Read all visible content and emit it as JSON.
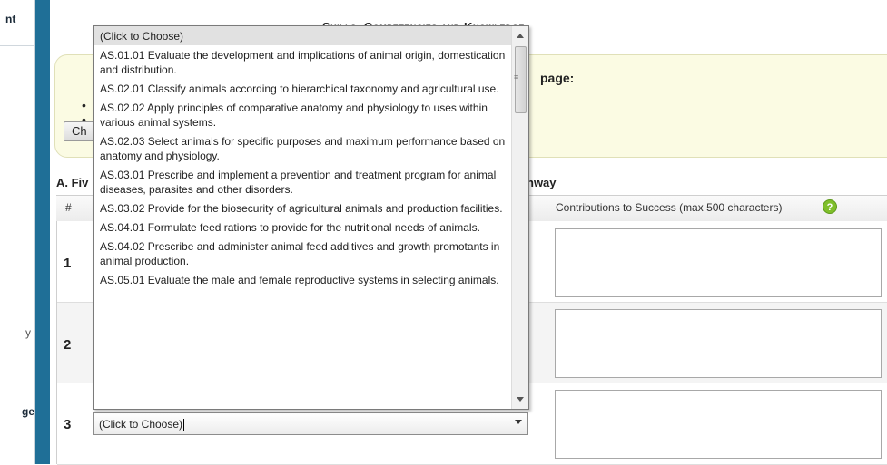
{
  "sidebar": {
    "cut_labels": [
      "nt",
      "y",
      "ge"
    ]
  },
  "page": {
    "heading": "Skills, Competencies and Knowledge"
  },
  "info": {
    "title": "page:",
    "bullets": [
      "•",
      "•"
    ],
    "button_label": "Ch"
  },
  "section": {
    "heading": "A. Fiv",
    "heading_tail": "hway"
  },
  "table": {
    "columns": [
      "#",
      "Contributions to Success (max 500 characters)"
    ],
    "help_icon": "?",
    "rows": [
      {
        "num": "1"
      },
      {
        "num": "2"
      },
      {
        "num": "3"
      }
    ]
  },
  "select": {
    "value": "(Click to Choose)"
  },
  "dropdown": {
    "options": [
      "(Click to Choose)",
      "AS.01.01 Evaluate the development and implications of animal origin, domestication and distribution.",
      "AS.02.01 Classify animals according to hierarchical taxonomy and agricultural use.",
      "AS.02.02 Apply principles of comparative anatomy and physiology to uses within various animal systems.",
      "AS.02.03 Select animals for specific purposes and maximum performance based on anatomy and physiology.",
      "AS.03.01 Prescribe and implement a prevention and treatment program for animal diseases, parasites and other disorders.",
      "AS.03.02 Provide for the biosecurity of agricultural animals and production facilities.",
      "AS.04.01 Formulate feed rations to provide for the nutritional needs of animals.",
      "AS.04.02 Prescribe and administer animal feed additives and growth promotants in animal production.",
      "AS.05.01 Evaluate the male and female reproductive systems in selecting animals."
    ],
    "thumb_grip": "≡"
  },
  "colors": {
    "sidebar": "#1f6f97",
    "info_bg": "#fbfbe3",
    "help_icon": "#7fbf2a"
  }
}
